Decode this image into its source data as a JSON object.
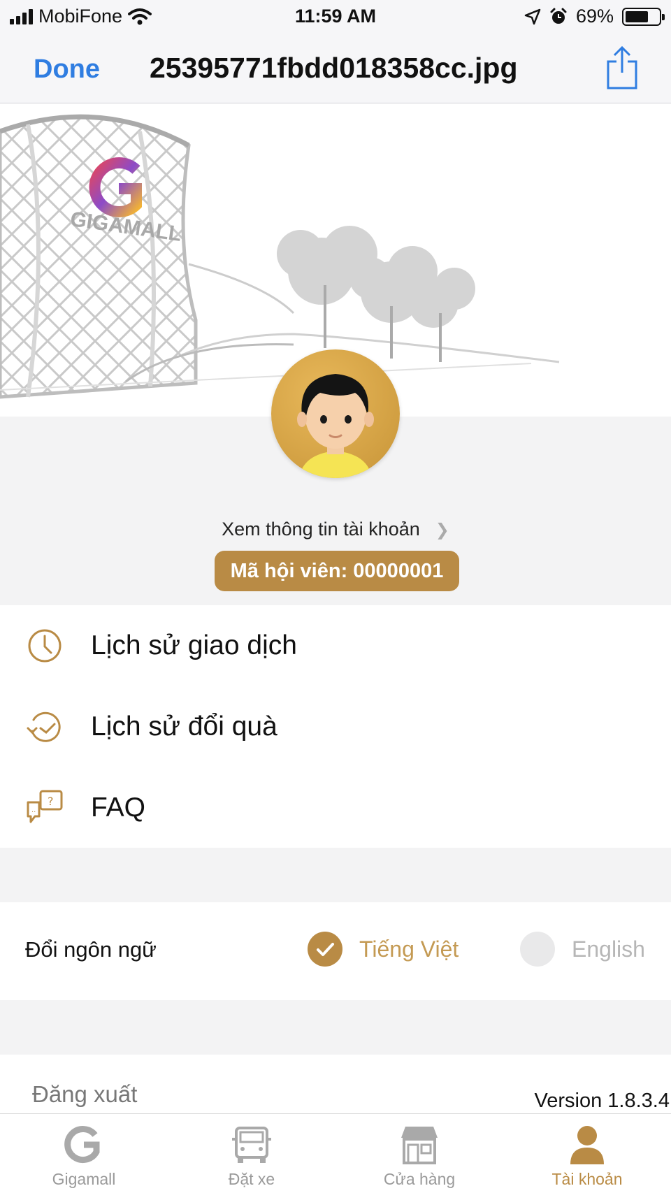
{
  "status_bar": {
    "carrier": "MobiFone",
    "time": "11:59 AM",
    "battery_percent": "69%",
    "battery_level": 0.69,
    "icons": [
      "signal-icon",
      "wifi-icon",
      "location-icon",
      "alarm-icon",
      "battery-icon"
    ]
  },
  "nav": {
    "done_label": "Done",
    "title": "25395771fbdd018358cc.jpg",
    "share_icon": "share-icon",
    "accent_color": "#2f7de1"
  },
  "hero": {
    "logo_text": "GIGAMALL"
  },
  "profile": {
    "account_link": "Xem thông tin tài khoản",
    "member_code": "Mã hội viên: 00000001"
  },
  "menu": {
    "items": [
      {
        "label": "Lịch sử giao dịch",
        "icon": "clock-icon"
      },
      {
        "label": "Lịch sử đổi quà",
        "icon": "history-icon"
      },
      {
        "label": "FAQ",
        "icon": "faq-chat-icon"
      }
    ]
  },
  "language": {
    "title": "Đổi ngôn ngữ",
    "options": [
      {
        "label": "Tiếng Việt",
        "selected": true
      },
      {
        "label": "English",
        "selected": false
      }
    ]
  },
  "footer": {
    "logout": "Đăng xuất",
    "version": "Version 1.8.3.4"
  },
  "tabs": [
    {
      "label": "Gigamall",
      "icon": "gigamall-icon",
      "active": false
    },
    {
      "label": "Đặt xe",
      "icon": "car-icon",
      "active": false
    },
    {
      "label": "Cửa hàng",
      "icon": "store-icon",
      "active": false
    },
    {
      "label": "Tài khoản",
      "icon": "account-icon",
      "active": true
    }
  ],
  "colors": {
    "gold": "#b98b45",
    "gold_text": "#c49a53",
    "tab_inactive": "#9a9a9a",
    "background_gray": "#f3f3f4"
  }
}
